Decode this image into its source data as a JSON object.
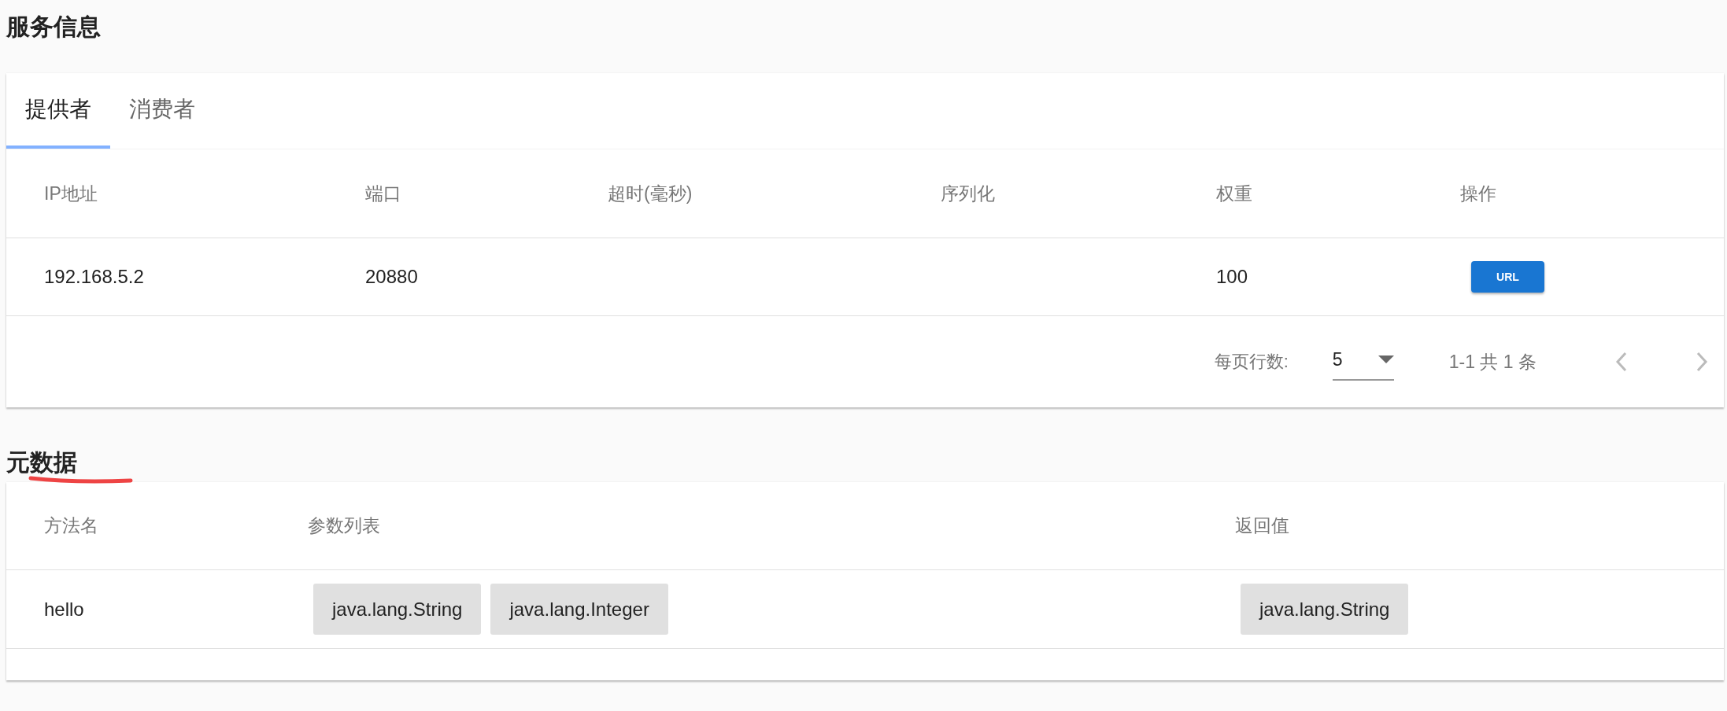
{
  "service_info": {
    "title": "服务信息",
    "tabs": [
      {
        "label": "提供者",
        "selected": true
      },
      {
        "label": "消费者",
        "selected": false
      }
    ],
    "table": {
      "columns": [
        "IP地址",
        "端口",
        "超时(毫秒)",
        "序列化",
        "权重",
        "操作"
      ],
      "rows": [
        {
          "cells": [
            "192.168.5.2",
            "20880",
            "",
            "",
            "100"
          ],
          "action": "URL"
        }
      ]
    },
    "pagination": {
      "rows_per_page_label": "每页行数:",
      "rows_per_page": "5",
      "range": "1-1 共 1 条"
    }
  },
  "metadata": {
    "title": "元数据",
    "table": {
      "columns": [
        "方法名",
        "参数列表",
        "返回值"
      ],
      "rows": [
        {
          "method": "hello",
          "params": [
            "java.lang.String",
            "java.lang.Integer"
          ],
          "returns": [
            "java.lang.String"
          ]
        }
      ]
    }
  }
}
